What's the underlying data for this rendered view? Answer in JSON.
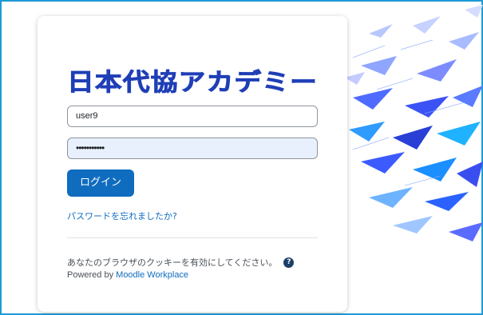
{
  "logo": {
    "text": "日本代協アカデミー"
  },
  "form": {
    "username_value": "user9",
    "password_value": "•••••••••••",
    "login_label": "ログイン",
    "forgot_label": "パスワードを忘れましたか?"
  },
  "footer": {
    "cookies_text": "あなたのブラウザのクッキーを有効にしてください。",
    "help_icon_glyph": "?",
    "powered_prefix": "Powered by ",
    "powered_link": "Moodle Workplace"
  },
  "colors": {
    "frame_border": "#1d9ad6",
    "primary": "#0f6cbf",
    "logo": "#1f3fb6",
    "autofill_bg": "#e8f0fe"
  },
  "icons": [
    "help-icon"
  ]
}
